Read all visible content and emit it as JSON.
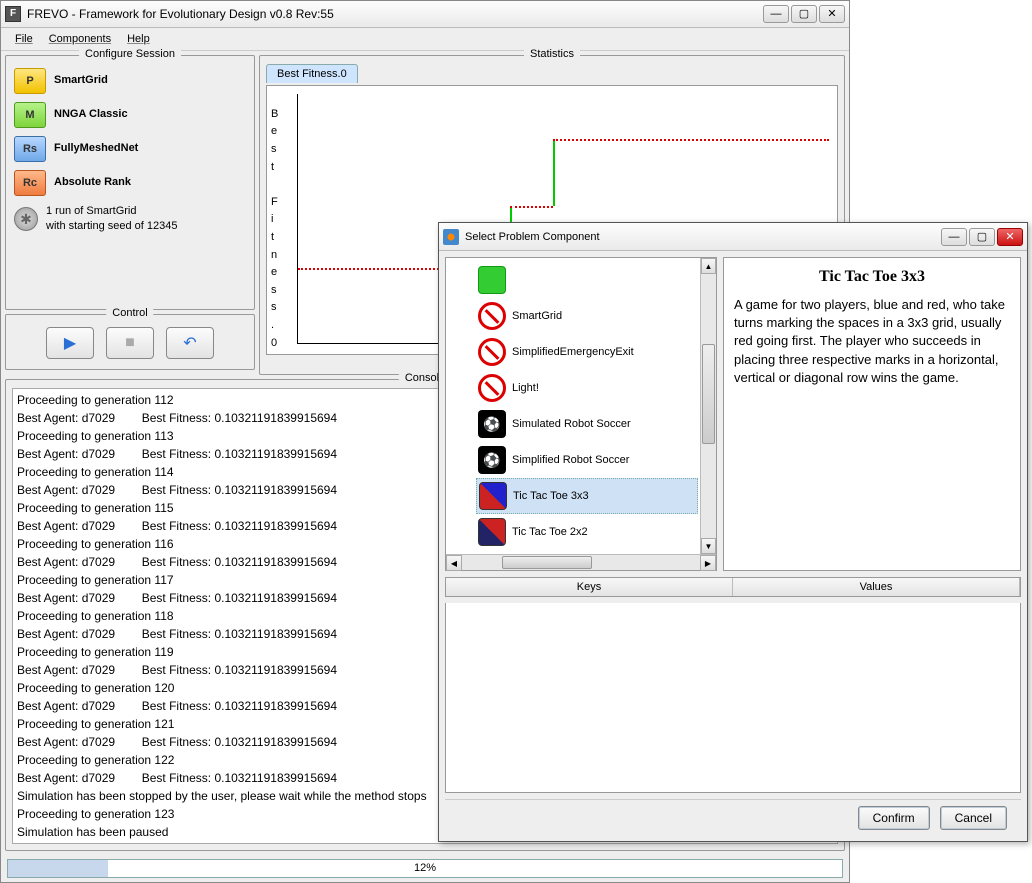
{
  "window": {
    "title": "FREVO - Framework for Evolutionary Design v0.8 Rev:55",
    "menu": {
      "file": "File",
      "components": "Components",
      "help": "Help"
    }
  },
  "configure": {
    "legend": "Configure Session",
    "items": [
      {
        "label": "SmartGrid",
        "iconLetter": "P"
      },
      {
        "label": "NNGA Classic",
        "iconLetter": "M"
      },
      {
        "label": "FullyMeshedNet",
        "iconLetter": "Rs"
      },
      {
        "label": "Absolute Rank",
        "iconLetter": "Rc"
      }
    ],
    "run_line1": "1 run of SmartGrid",
    "run_line2": "with starting seed of 12345"
  },
  "control": {
    "legend": "Control"
  },
  "stats": {
    "legend": "Statistics",
    "tab": "Best Fitness.0",
    "ylabel": "Best Fitness.0"
  },
  "console": {
    "legend": "Console",
    "lines": [
      "Proceeding to generation 112",
      "Best Agent: d7029        Best Fitness: 0.10321191839915694",
      "Proceeding to generation 113",
      "Best Agent: d7029        Best Fitness: 0.10321191839915694",
      "Proceeding to generation 114",
      "Best Agent: d7029        Best Fitness: 0.10321191839915694",
      "Proceeding to generation 115",
      "Best Agent: d7029        Best Fitness: 0.10321191839915694",
      "Proceeding to generation 116",
      "Best Agent: d7029        Best Fitness: 0.10321191839915694",
      "Proceeding to generation 117",
      "Best Agent: d7029        Best Fitness: 0.10321191839915694",
      "Proceeding to generation 118",
      "Best Agent: d7029        Best Fitness: 0.10321191839915694",
      "Proceeding to generation 119",
      "Best Agent: d7029        Best Fitness: 0.10321191839915694",
      "Proceeding to generation 120",
      "Best Agent: d7029        Best Fitness: 0.10321191839915694",
      "Proceeding to generation 121",
      "Best Agent: d7029        Best Fitness: 0.10321191839915694",
      "Proceeding to generation 122",
      "Best Agent: d7029        Best Fitness: 0.10321191839915694",
      "Simulation has been stopped by the user, please wait while the method stops",
      "Proceeding to generation 123",
      "Simulation has been paused"
    ]
  },
  "progress": {
    "text": "12%",
    "percent": 12
  },
  "dialog": {
    "title": "Select Problem Component",
    "tree": [
      {
        "label": "",
        "icon": "green"
      },
      {
        "label": "SmartGrid",
        "icon": "noentry"
      },
      {
        "label": "SimplifiedEmergencyExit",
        "icon": "noentry"
      },
      {
        "label": "Light!",
        "icon": "noentry"
      },
      {
        "label": "Simulated Robot Soccer",
        "icon": "soccer"
      },
      {
        "label": "Simplified Robot Soccer",
        "icon": "soccer"
      },
      {
        "label": "Tic Tac Toe 3x3",
        "icon": "ttt",
        "selected": true
      },
      {
        "label": "Tic Tac Toe 2x2",
        "icon": "ttt2"
      }
    ],
    "desc_title": "Tic Tac Toe 3x3",
    "desc_body": "A game for two players, blue and red, who take turns marking the spaces in a 3x3 grid, usually red going first. The player who succeeds in placing three respective marks in a horizontal, vertical or diagonal row wins the game.",
    "kv": {
      "keys": "Keys",
      "values": "Values"
    },
    "confirm": "Confirm",
    "cancel": "Cancel"
  },
  "chart_data": {
    "type": "line",
    "title": "Best Fitness.0",
    "ylabel": "Best Fitness.0",
    "series": [
      {
        "name": "Best Fitness.0",
        "steps": [
          {
            "x": 0,
            "y": 0.3
          },
          {
            "x": 0.4,
            "y": 0.3
          },
          {
            "x": 0.4,
            "y": 0.55
          },
          {
            "x": 0.48,
            "y": 0.55
          },
          {
            "x": 0.48,
            "y": 0.82
          },
          {
            "x": 1.0,
            "y": 0.82
          }
        ]
      }
    ]
  }
}
